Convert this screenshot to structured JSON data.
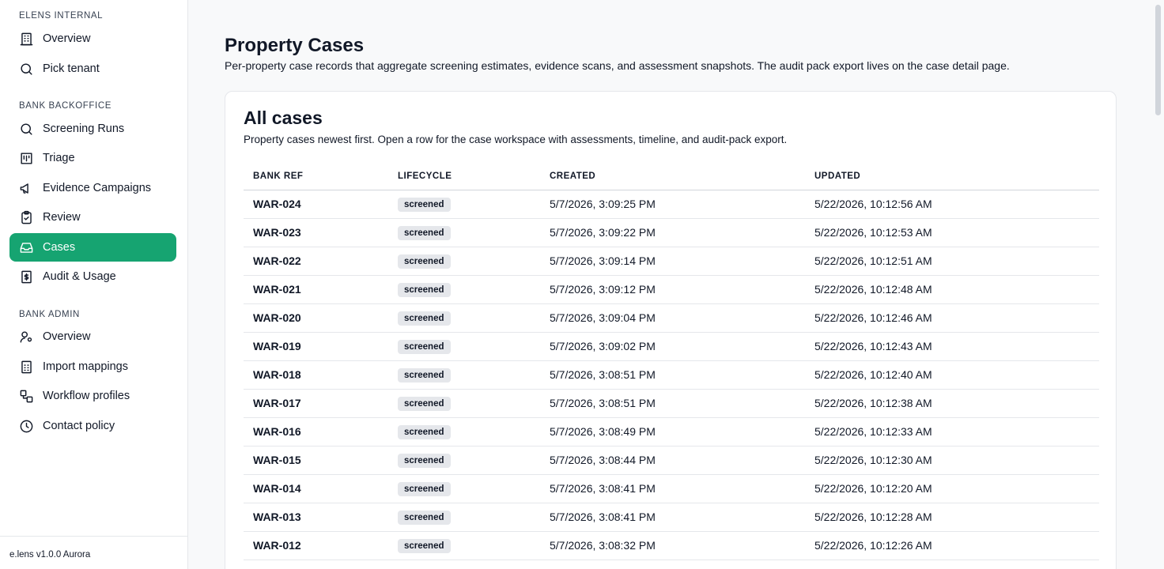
{
  "sidebar": {
    "sections": [
      {
        "title": "ELENS INTERNAL"
      },
      {
        "title": "BANK BACKOFFICE"
      },
      {
        "title": "BANK ADMIN"
      }
    ],
    "items": [
      {
        "label": "Overview",
        "icon": "building-icon"
      },
      {
        "label": "Pick tenant",
        "icon": "search-icon"
      },
      {
        "label": "Screening Runs",
        "icon": "search-icon"
      },
      {
        "label": "Triage",
        "icon": "kanban-icon"
      },
      {
        "label": "Evidence Campaigns",
        "icon": "megaphone-icon"
      },
      {
        "label": "Review",
        "icon": "clipboard-check-icon"
      },
      {
        "label": "Cases",
        "icon": "inbox-icon",
        "active": true
      },
      {
        "label": "Audit & Usage",
        "icon": "receipt-icon"
      },
      {
        "label": "Overview",
        "icon": "user-cog-icon"
      },
      {
        "label": "Import mappings",
        "icon": "file-spreadsheet-icon"
      },
      {
        "label": "Workflow profiles",
        "icon": "workflow-icon"
      },
      {
        "label": "Contact policy",
        "icon": "clock-icon"
      }
    ],
    "footer": "e.lens v1.0.0 Aurora"
  },
  "main": {
    "title": "Property Cases",
    "subtitle": "Per-property case records that aggregate screening estimates, evidence scans, and assessment snapshots. The audit pack export lives on the case detail page.",
    "card": {
      "title": "All cases",
      "subtitle": "Property cases newest first. Open a row for the case workspace with assessments, timeline, and audit-pack export.",
      "columns": [
        "BANK REF",
        "LIFECYCLE",
        "CREATED",
        "UPDATED"
      ],
      "rows": [
        {
          "ref": "WAR-024",
          "lifecycle": "screened",
          "created": "5/7/2026, 3:09:25 PM",
          "updated": "5/22/2026, 10:12:56 AM"
        },
        {
          "ref": "WAR-023",
          "lifecycle": "screened",
          "created": "5/7/2026, 3:09:22 PM",
          "updated": "5/22/2026, 10:12:53 AM"
        },
        {
          "ref": "WAR-022",
          "lifecycle": "screened",
          "created": "5/7/2026, 3:09:14 PM",
          "updated": "5/22/2026, 10:12:51 AM"
        },
        {
          "ref": "WAR-021",
          "lifecycle": "screened",
          "created": "5/7/2026, 3:09:12 PM",
          "updated": "5/22/2026, 10:12:48 AM"
        },
        {
          "ref": "WAR-020",
          "lifecycle": "screened",
          "created": "5/7/2026, 3:09:04 PM",
          "updated": "5/22/2026, 10:12:46 AM"
        },
        {
          "ref": "WAR-019",
          "lifecycle": "screened",
          "created": "5/7/2026, 3:09:02 PM",
          "updated": "5/22/2026, 10:12:43 AM"
        },
        {
          "ref": "WAR-018",
          "lifecycle": "screened",
          "created": "5/7/2026, 3:08:51 PM",
          "updated": "5/22/2026, 10:12:40 AM"
        },
        {
          "ref": "WAR-017",
          "lifecycle": "screened",
          "created": "5/7/2026, 3:08:51 PM",
          "updated": "5/22/2026, 10:12:38 AM"
        },
        {
          "ref": "WAR-016",
          "lifecycle": "screened",
          "created": "5/7/2026, 3:08:49 PM",
          "updated": "5/22/2026, 10:12:33 AM"
        },
        {
          "ref": "WAR-015",
          "lifecycle": "screened",
          "created": "5/7/2026, 3:08:44 PM",
          "updated": "5/22/2026, 10:12:30 AM"
        },
        {
          "ref": "WAR-014",
          "lifecycle": "screened",
          "created": "5/7/2026, 3:08:41 PM",
          "updated": "5/22/2026, 10:12:20 AM"
        },
        {
          "ref": "WAR-013",
          "lifecycle": "screened",
          "created": "5/7/2026, 3:08:41 PM",
          "updated": "5/22/2026, 10:12:28 AM"
        },
        {
          "ref": "WAR-012",
          "lifecycle": "screened",
          "created": "5/7/2026, 3:08:32 PM",
          "updated": "5/22/2026, 10:12:26 AM"
        },
        {
          "ref": "",
          "lifecycle": "",
          "created": "",
          "updated": ""
        }
      ]
    }
  },
  "colors": {
    "accent": "#16a471",
    "badge_bg": "#e5e7eb",
    "page_bg": "#f8f9fa"
  }
}
